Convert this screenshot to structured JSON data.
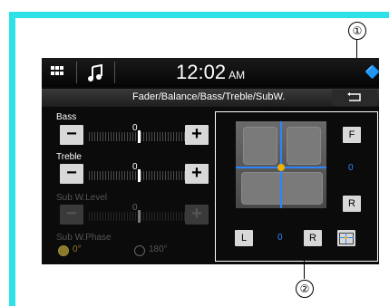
{
  "header": {
    "clock": "12:02",
    "ampm": "AM"
  },
  "title": "Fader/Balance/Bass/Treble/SubW.",
  "controls": {
    "bass": {
      "label": "Bass",
      "value": "0",
      "minus": "−",
      "plus": "+"
    },
    "treble": {
      "label": "Treble",
      "value": "0",
      "minus": "−",
      "plus": "+"
    },
    "subw_level": {
      "label": "Sub W.Level",
      "value": "0",
      "minus": "−",
      "plus": "+"
    },
    "subw_phase": {
      "label": "Sub W.Phase",
      "options": [
        "0°",
        "180°"
      ],
      "selected": "0°"
    }
  },
  "panel": {
    "front_btn": "F",
    "rear_btn": "R",
    "fader_value": "0",
    "left_btn": "L",
    "right_btn": "R",
    "balance_value": "0"
  },
  "callouts": {
    "one": "①",
    "two": "②"
  },
  "colors": {
    "frame": "#2ee0e8",
    "accent_blue": "#2a86ff",
    "center_dot": "#f0b000"
  },
  "icons": {
    "menu": "grid-icon",
    "music": "music-note-icon",
    "bluetooth": "bluetooth-icon",
    "back": "back-arrow-icon"
  }
}
